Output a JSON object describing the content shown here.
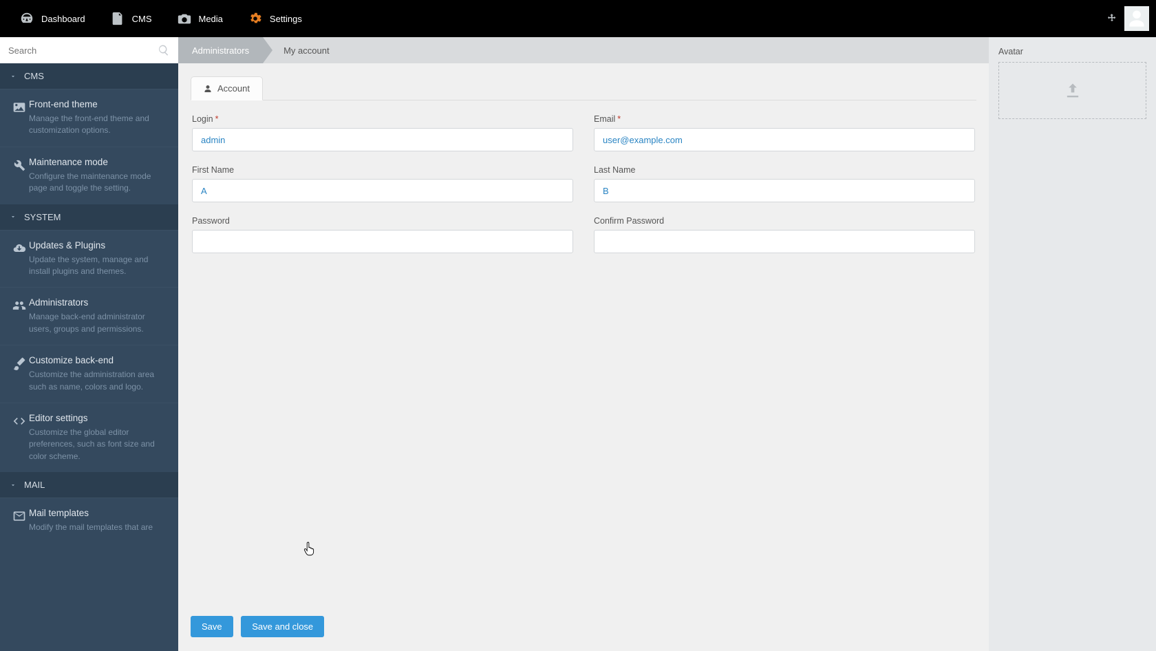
{
  "topnav": {
    "items": [
      {
        "label": "Dashboard",
        "icon": "gauge-icon"
      },
      {
        "label": "CMS",
        "icon": "pages-icon"
      },
      {
        "label": "Media",
        "icon": "camera-icon"
      },
      {
        "label": "Settings",
        "icon": "gears-icon"
      }
    ]
  },
  "search": {
    "placeholder": "Search"
  },
  "sidebar": {
    "sections": [
      {
        "title": "CMS",
        "items": [
          {
            "title": "Front-end theme",
            "desc": "Manage the front-end theme and customization options.",
            "icon": "image-icon"
          },
          {
            "title": "Maintenance mode",
            "desc": "Configure the maintenance mode page and toggle the setting.",
            "icon": "wrench-icon"
          }
        ]
      },
      {
        "title": "SYSTEM",
        "items": [
          {
            "title": "Updates & Plugins",
            "desc": "Update the system, manage and install plugins and themes.",
            "icon": "cloud-download-icon"
          },
          {
            "title": "Administrators",
            "desc": "Manage back-end administrator users, groups and permissions.",
            "icon": "users-icon"
          },
          {
            "title": "Customize back-end",
            "desc": "Customize the administration area such as name, colors and logo.",
            "icon": "paintbrush-icon"
          },
          {
            "title": "Editor settings",
            "desc": "Customize the global editor preferences, such as font size and color scheme.",
            "icon": "code-icon"
          }
        ]
      },
      {
        "title": "MAIL",
        "items": [
          {
            "title": "Mail templates",
            "desc": "Modify the mail templates that are",
            "icon": "envelope-icon"
          }
        ]
      }
    ]
  },
  "breadcrumb": {
    "first": "Administrators",
    "second": "My account"
  },
  "tab": {
    "label": "Account"
  },
  "form": {
    "login": {
      "label": "Login",
      "required": true,
      "value": "admin"
    },
    "email": {
      "label": "Email",
      "required": true,
      "value": "user@example.com"
    },
    "first_name": {
      "label": "First Name",
      "value": "A"
    },
    "last_name": {
      "label": "Last Name",
      "value": "B"
    },
    "password": {
      "label": "Password"
    },
    "confirm_password": {
      "label": "Confirm Password"
    }
  },
  "buttons": {
    "save": "Save",
    "save_close": "Save and close"
  },
  "right_panel": {
    "avatar_label": "Avatar"
  }
}
